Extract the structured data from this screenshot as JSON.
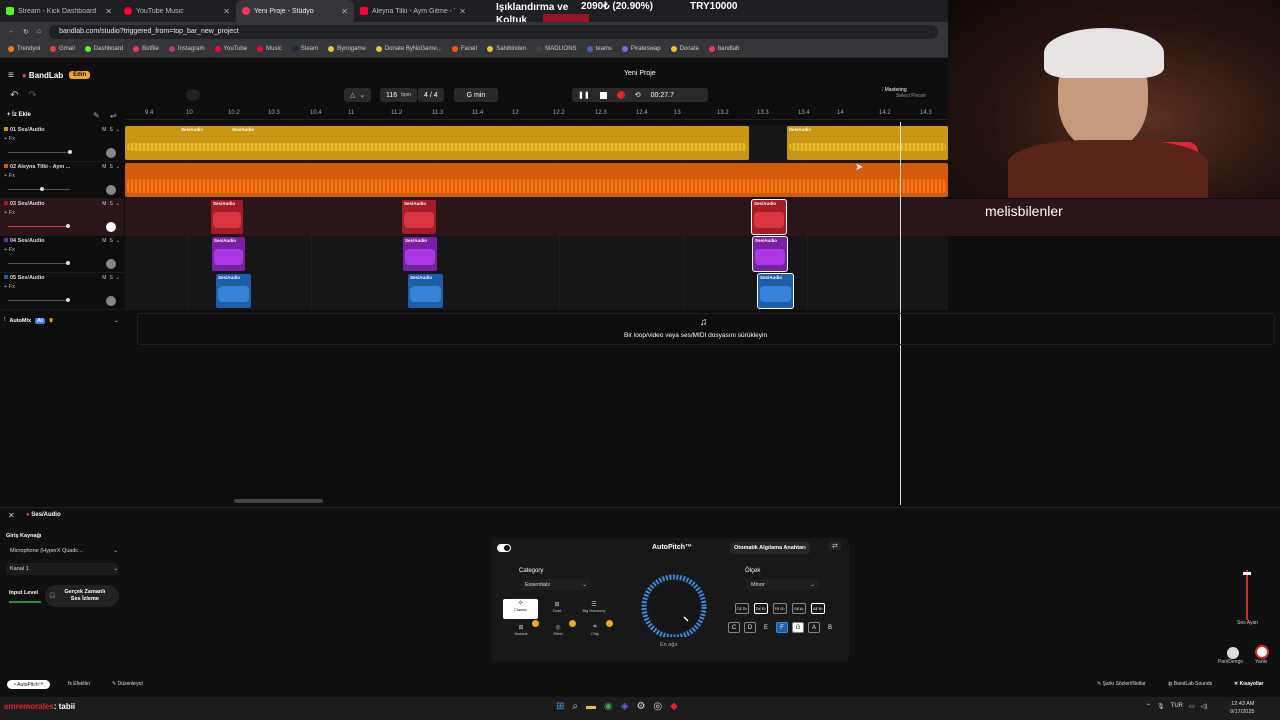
{
  "browser": {
    "tabs": [
      {
        "label": "Stream - Kick Dashboard",
        "color": "#53fc18"
      },
      {
        "label": "YouTube Music",
        "color": "#ff0033"
      },
      {
        "label": "Yeni Proje - Stüdyo",
        "color": "#f2375b"
      },
      {
        "label": "Aleyna Tilki - Aym Gitme - YouT",
        "color": "#ff0033"
      }
    ],
    "url": "bandlab.com/studio?triggered_from=top_bar_new_project",
    "bookmarks": [
      "Trendyol",
      "Gmail",
      "Dashboard",
      "Botfile",
      "Instagram",
      "YouTube",
      "Music",
      "Steam",
      "Bynogame",
      "Donate ByNoGame...",
      "Faceit",
      "Sahibinden",
      "MADLIONS",
      "teams",
      "Pirateswap",
      "Donate",
      "bandlab"
    ]
  },
  "overlay": {
    "line1": "Işıklandırma ve",
    "line2": "Koltuk",
    "amount": "2090₺ (20.90%)",
    "goal": "TRY10000"
  },
  "bandlab": {
    "logo": "BandLab",
    "edit_badge": "Edin",
    "project_title": "Yeni Proje",
    "tempo": "116",
    "tempo_unit": "bpm",
    "time_sig": "4 / 4",
    "key": "G min",
    "time": "00:27.7",
    "mastering": "Mastering",
    "select_preset": "Select Preset",
    "add_track": "+ İz Ekle",
    "ruler": [
      "9.4",
      "10",
      "10.2",
      "10.3",
      "10.4",
      "11",
      "11.2",
      "11.3",
      "11.4",
      "12",
      "12.2",
      "12.3",
      "12.4",
      "13",
      "13.2",
      "13.3",
      "13.4",
      "14",
      "14.2",
      "14.3"
    ],
    "tracks": [
      {
        "name": "01 Ses/Audio",
        "fx": "+ Fx",
        "m": "M",
        "s": "S"
      },
      {
        "name": "02 Aleyna Tilki - Aym ...",
        "fx": "+ Fx",
        "m": "M",
        "s": "S"
      },
      {
        "name": "03 Ses/Audio",
        "fx": "+ Fx",
        "m": "M",
        "s": "S"
      },
      {
        "name": "04 Ses/Audio",
        "fx": "+ Fx",
        "m": "M",
        "s": "S"
      },
      {
        "name": "05 Ses/Audio",
        "fx": "+ Fx",
        "m": "M",
        "s": "S"
      }
    ],
    "clip_label": "Ses/Audio",
    "automix": "AutoMix",
    "ai": "AI",
    "drop_hint": "Bir loop/video veya ses/MIDI dosyasını sürükleyin"
  },
  "webcam": {
    "username": "melisbilenler"
  },
  "panel": {
    "title": "Ses/Audio",
    "input_source_label": "Giriş Kaynağı",
    "input_device": "Microphone (HyperX Quadc...",
    "channel": "Kanal 1",
    "input_level": "Input Level",
    "monitoring": "Gerçek Zamanlı Ses İzleme",
    "autopitch": "AutoPitch™",
    "auto_key": "Otomatik Algılama Anahtarı",
    "category_label": "Category",
    "category": "Essentials",
    "presets": [
      "Classic",
      "Duet",
      "Big Harmony",
      "Natural",
      "Efekt",
      "Chip"
    ],
    "dial_label": "En ağır",
    "scale_label": "Ölçek",
    "scale": "Minor",
    "notes_top": [
      "C♯ D♭",
      "D♯ E♭",
      "F♯ G♭",
      "G♯ A♭",
      "A♯ B♭"
    ],
    "notes_bottom": [
      "C",
      "D",
      "E",
      "F",
      "G",
      "A",
      "B"
    ],
    "master_label": "Ses Ayarı",
    "pan_label": "Pan/Denge",
    "reverb_label": "Yankı",
    "bottom_tabs": [
      "AutoPitch™",
      "Efektler",
      "Düzenleyici"
    ],
    "bottom_right": [
      "Şarkı Sözleri/Notlar",
      "BandLab Sounds",
      "Kısayollar"
    ]
  },
  "chat": {
    "user": "emremorales",
    "message": ": tabii"
  },
  "taskbar": {
    "lang": "TUR",
    "time": "12:43 AM",
    "date": "9/17/2025"
  }
}
